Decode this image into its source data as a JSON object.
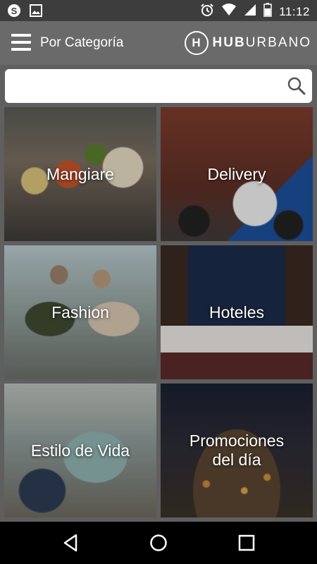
{
  "status_bar": {
    "time": "11:12",
    "left_icons": [
      "skype-icon",
      "image-icon"
    ],
    "right_icons": [
      "alarm-icon",
      "wifi-icon",
      "signal-icon",
      "battery-icon"
    ]
  },
  "app_bar": {
    "title": "Por Categoría",
    "logo": {
      "mark": "H",
      "text_bold": "HUB",
      "text_light": "URBANO"
    }
  },
  "search": {
    "value": "",
    "placeholder": ""
  },
  "categories": [
    {
      "label": "Mangiare"
    },
    {
      "label": "Delivery"
    },
    {
      "label": "Fashion"
    },
    {
      "label": "Hoteles"
    },
    {
      "label": "Estilo de Vida"
    },
    {
      "label": "Promociones del día"
    }
  ],
  "nav_bar": {
    "icons": [
      "back-icon",
      "home-icon",
      "recents-icon"
    ]
  },
  "colors": {
    "status_bar": "#3d3d3d",
    "app_bar": "#6a6a6a",
    "background": "#5f5f5f",
    "nav_bar": "#000000"
  }
}
